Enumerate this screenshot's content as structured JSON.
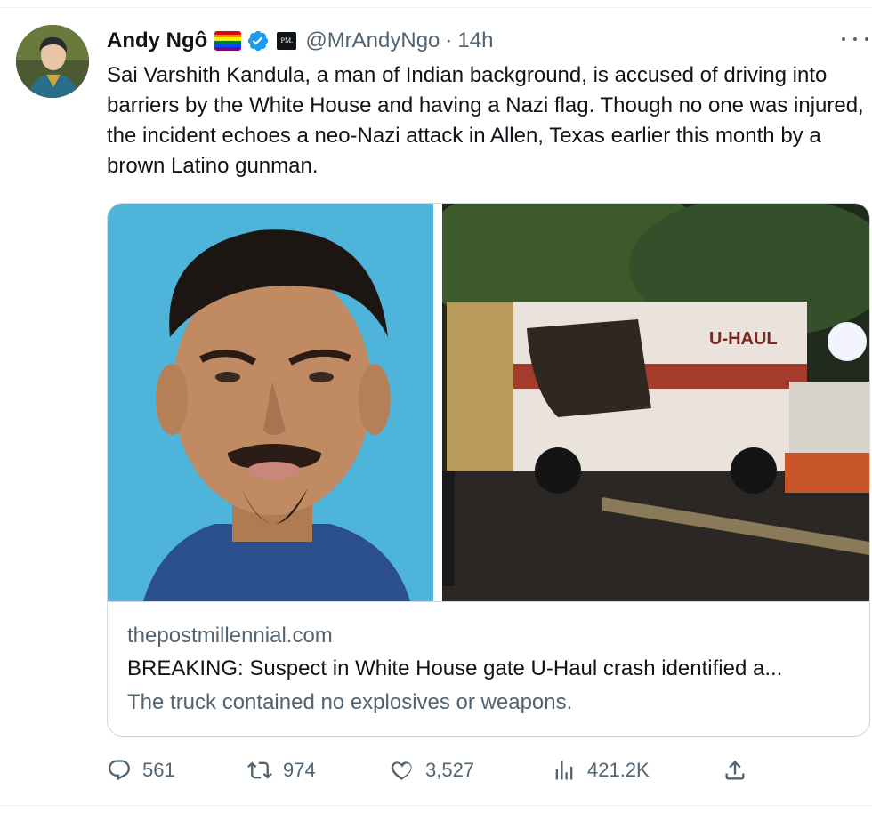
{
  "tweet": {
    "author_name": "Andy Ngô",
    "handle": "@MrAndyNgo",
    "separator": "·",
    "time": "14h",
    "affiliate_badge": "PM.",
    "text": "Sai Varshith Kandula, a man of Indian background, is accused of driving into barriers by the White House and having a Nazi flag. Though no one was injured, the incident echoes a neo-Nazi attack in Allen, Texas earlier this month by a brown Latino gunman."
  },
  "card": {
    "domain": "thepostmillennial.com",
    "title": "BREAKING: Suspect in White House gate U-Haul crash identified a...",
    "description": "The truck contained no explosives or weapons.",
    "truck_text": "U-HAUL"
  },
  "actions": {
    "replies": "561",
    "retweets": "974",
    "likes": "3,527",
    "views": "421.2K"
  },
  "icons": {
    "verified": "verified-badge-icon",
    "pride_flag": "pride-flag-icon",
    "more": "more-options-icon",
    "reply": "reply-icon",
    "retweet": "retweet-icon",
    "like": "heart-icon",
    "views": "views-icon",
    "share": "share-icon"
  },
  "colors": {
    "verified_blue": "#1d9bf0",
    "secondary_text": "#536471",
    "primary_text": "#0f1419",
    "border": "#cfd9de"
  }
}
